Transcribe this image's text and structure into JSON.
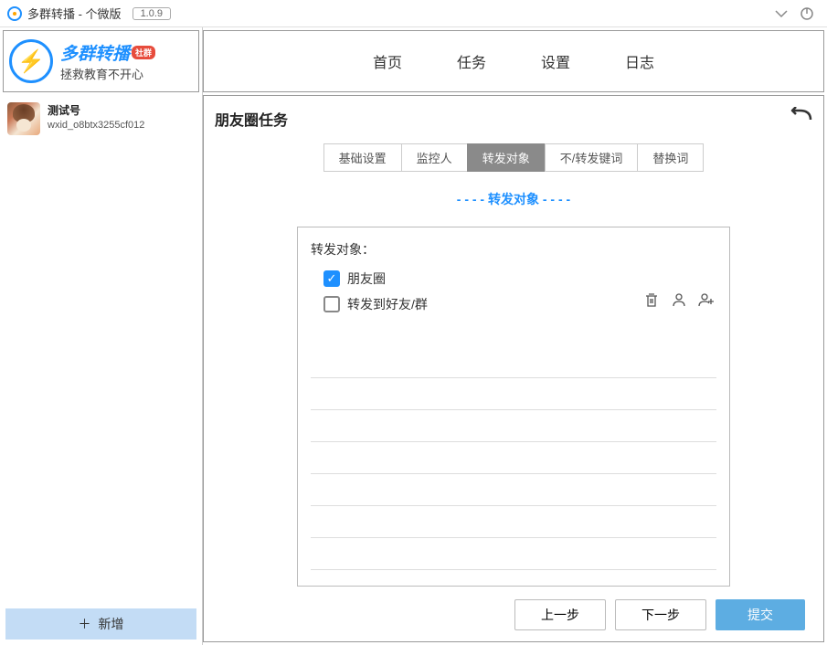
{
  "titlebar": {
    "title": "多群转播 - 个微版",
    "version": "1.0.9"
  },
  "logo": {
    "title": "多群转播",
    "badge": "社群",
    "subtitle": "拯救教育不开心"
  },
  "account": {
    "name": "测试号",
    "id": "wxid_o8btx3255cf012"
  },
  "sidebar": {
    "addButton": "新增"
  },
  "nav": {
    "items": [
      "首页",
      "任务",
      "设置",
      "日志"
    ]
  },
  "panel": {
    "title": "朋友圈任务",
    "tabs": [
      "基础设置",
      "监控人",
      "转发对象",
      "不/转发键词",
      "替换词"
    ],
    "activeTab": 2,
    "sectionTitle": "- - - - 转发对象 - - - -",
    "formLabel": "转发对象：",
    "checkbox1": "朋友圈",
    "checkbox2": "转发到好友/群"
  },
  "footer": {
    "prev": "上一步",
    "next": "下一步",
    "submit": "提交"
  }
}
